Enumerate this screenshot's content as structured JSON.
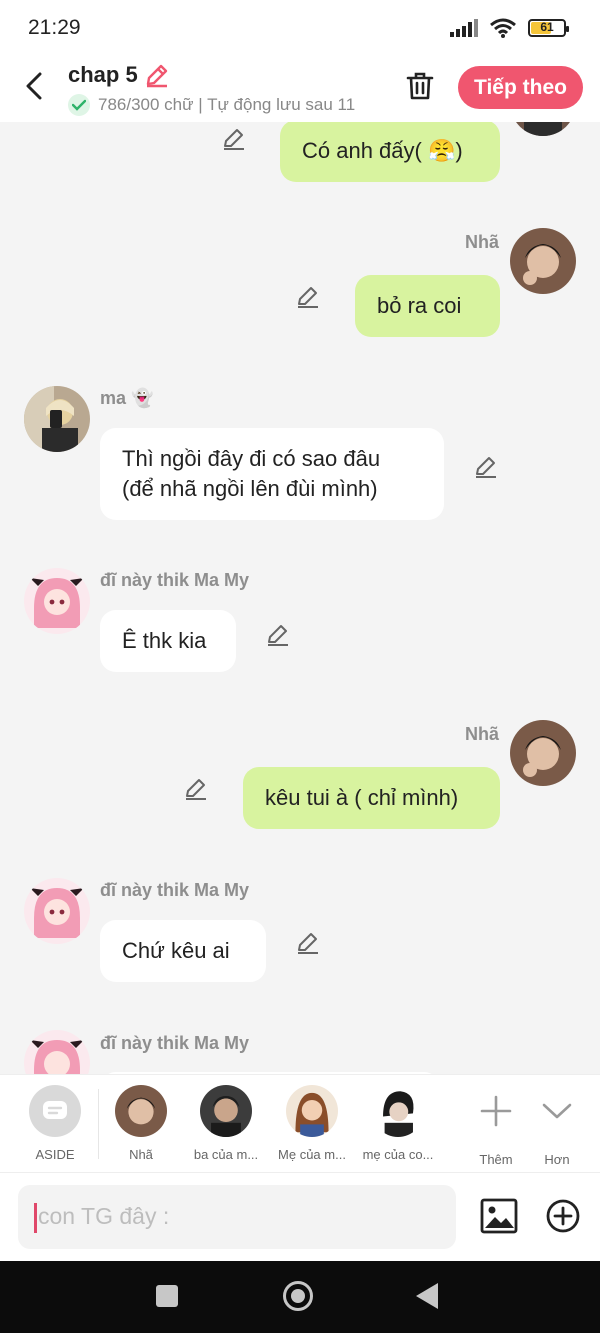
{
  "status_bar": {
    "time": "21:29",
    "battery": "61"
  },
  "header": {
    "title": "chap 5",
    "subtitle": "786/300 chữ | Tự động lưu sau 11",
    "next_label": "Tiếp theo"
  },
  "messages": [
    {
      "side": "right",
      "sender": "",
      "text": "Có anh đấy( 😤)"
    },
    {
      "side": "right",
      "sender": "Nhã",
      "text": "bỏ ra coi"
    },
    {
      "side": "left",
      "sender": "ma 👻",
      "text": "Thì ngồi đây đi có sao đâu\n(để nhã ngồi lên đùi mình)"
    },
    {
      "side": "left",
      "sender": "đĩ này thik Ma My",
      "text": "Ê thk kia"
    },
    {
      "side": "right",
      "sender": "Nhã",
      "text": "kêu tui à ( chỉ mình)"
    },
    {
      "side": "left",
      "sender": "đĩ này thik Ma My",
      "text": "Chứ kêu ai"
    },
    {
      "side": "left",
      "sender": "đĩ này thik Ma My",
      "text": ""
    }
  ],
  "characters": [
    {
      "label": "ASIDE"
    },
    {
      "label": "Nhã"
    },
    {
      "label": "ba của m..."
    },
    {
      "label": "Mẹ của m..."
    },
    {
      "label": "mẹ của co..."
    },
    {
      "label": "Thêm"
    },
    {
      "label": "Hơn"
    }
  ],
  "input": {
    "placeholder": "con TG đây :"
  }
}
